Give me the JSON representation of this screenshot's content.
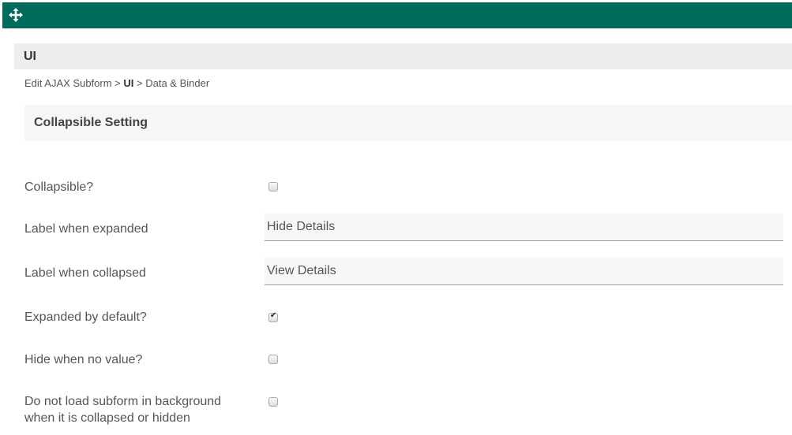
{
  "section_title": "UI",
  "breadcrumb": {
    "part1": "Edit AJAX Subform",
    "sep1": " > ",
    "current": "UI",
    "sep2": " > ",
    "part3": "Data & Binder"
  },
  "subsection_title": "Collapsible Setting",
  "fields": {
    "collapsible": {
      "label": "Collapsible?",
      "checked": false
    },
    "label_expanded": {
      "label": "Label when expanded",
      "value": "Hide Details"
    },
    "label_collapsed": {
      "label": "Label when collapsed",
      "value": "View Details"
    },
    "expanded_default": {
      "label": "Expanded by default?",
      "checked": true
    },
    "hide_no_value": {
      "label": "Hide when no value?",
      "checked": false
    },
    "no_load_bg": {
      "label_line1": "Do not load subform in background",
      "label_line2": "when it is collapsed or hidden",
      "checked": false
    }
  },
  "colors": {
    "topbar": "#006b5a"
  }
}
